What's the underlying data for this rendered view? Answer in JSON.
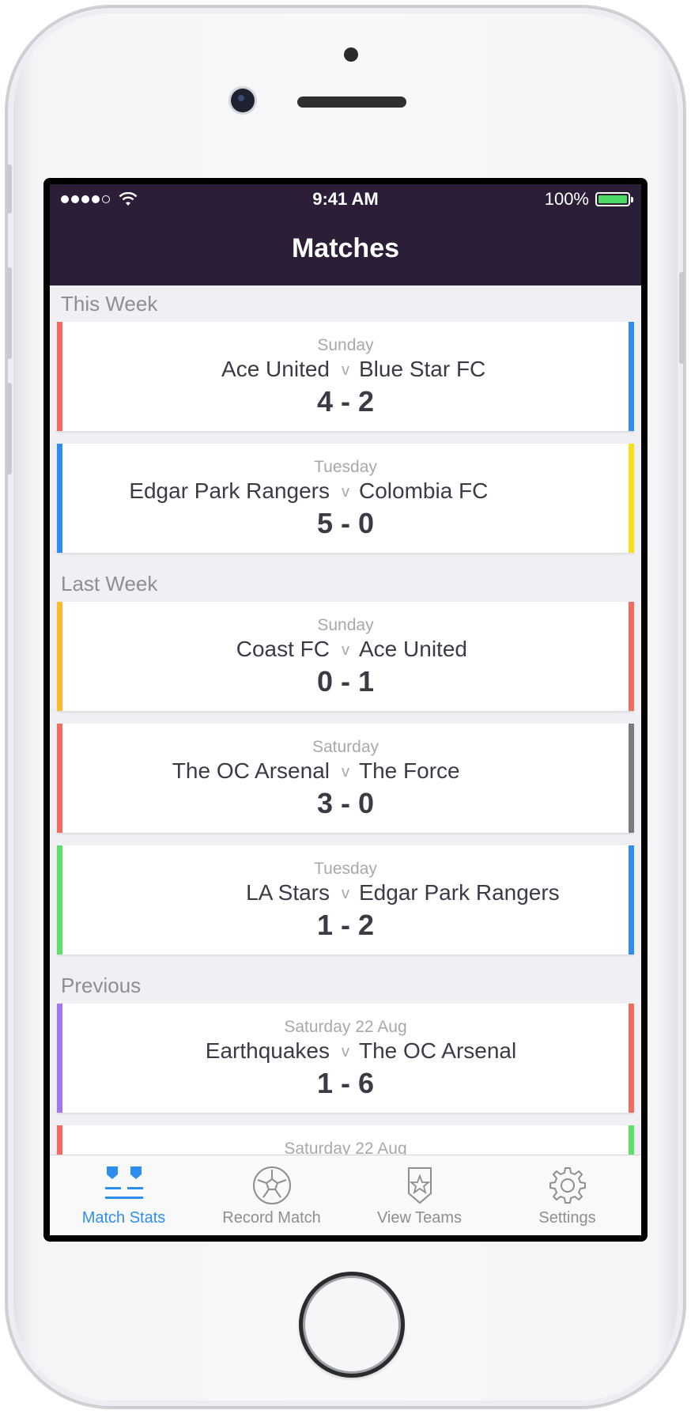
{
  "status_bar": {
    "time": "9:41 AM",
    "battery": "100%"
  },
  "header": {
    "title": "Matches"
  },
  "colors": {
    "nav_background": "#2b1f38",
    "tab_active": "#2e8ef0",
    "tab_inactive": "#8e8e93",
    "team_colors": [
      "#f26b5f",
      "#2e8ef0",
      "#f7e21a",
      "#fdbb2c",
      "#7c7a80",
      "#5ee06a",
      "#a277f2"
    ]
  },
  "sections": [
    {
      "title": "This Week",
      "matches": [
        {
          "date": "Sunday",
          "home": "Ace United",
          "vs": "v",
          "away": "Blue Star FC",
          "score": "4 - 2",
          "home_color": "#f26b5f",
          "away_color": "#2e8ef0"
        },
        {
          "date": "Tuesday",
          "home": "Edgar Park Rangers",
          "vs": "v",
          "away": "Colombia FC",
          "score": "5 - 0",
          "home_color": "#2e8ef0",
          "away_color": "#f7e21a"
        }
      ]
    },
    {
      "title": "Last Week",
      "matches": [
        {
          "date": "Sunday",
          "home": "Coast FC",
          "vs": "v",
          "away": "Ace United",
          "score": "0 - 1",
          "home_color": "#fdbb2c",
          "away_color": "#f26b5f"
        },
        {
          "date": "Saturday",
          "home": "The OC Arsenal",
          "vs": "v",
          "away": "The Force",
          "score": "3 - 0",
          "home_color": "#f26b5f",
          "away_color": "#7c7a80"
        },
        {
          "date": "Tuesday",
          "home": "LA Stars",
          "vs": "v",
          "away": "Edgar Park Rangers",
          "score": "1 - 2",
          "home_color": "#5ee06a",
          "away_color": "#2e8ef0"
        }
      ]
    },
    {
      "title": "Previous",
      "matches": [
        {
          "date": "Saturday 22 Aug",
          "home": "Earthquakes",
          "vs": "v",
          "away": "The OC Arsenal",
          "score": "1 - 6",
          "home_color": "#a277f2",
          "away_color": "#f26b5f"
        },
        {
          "date": "Saturday 22 Aug",
          "home": "",
          "vs": "",
          "away": "",
          "score": "",
          "home_color": "#f26b5f",
          "away_color": "#5ee06a"
        }
      ]
    }
  ],
  "tabbar": {
    "tabs": [
      {
        "label": "Match Stats",
        "icon": "match-stats-icon",
        "active": true
      },
      {
        "label": "Record Match",
        "icon": "soccer-ball-icon",
        "active": false
      },
      {
        "label": "View Teams",
        "icon": "shield-star-icon",
        "active": false
      },
      {
        "label": "Settings",
        "icon": "gear-icon",
        "active": false
      }
    ]
  }
}
